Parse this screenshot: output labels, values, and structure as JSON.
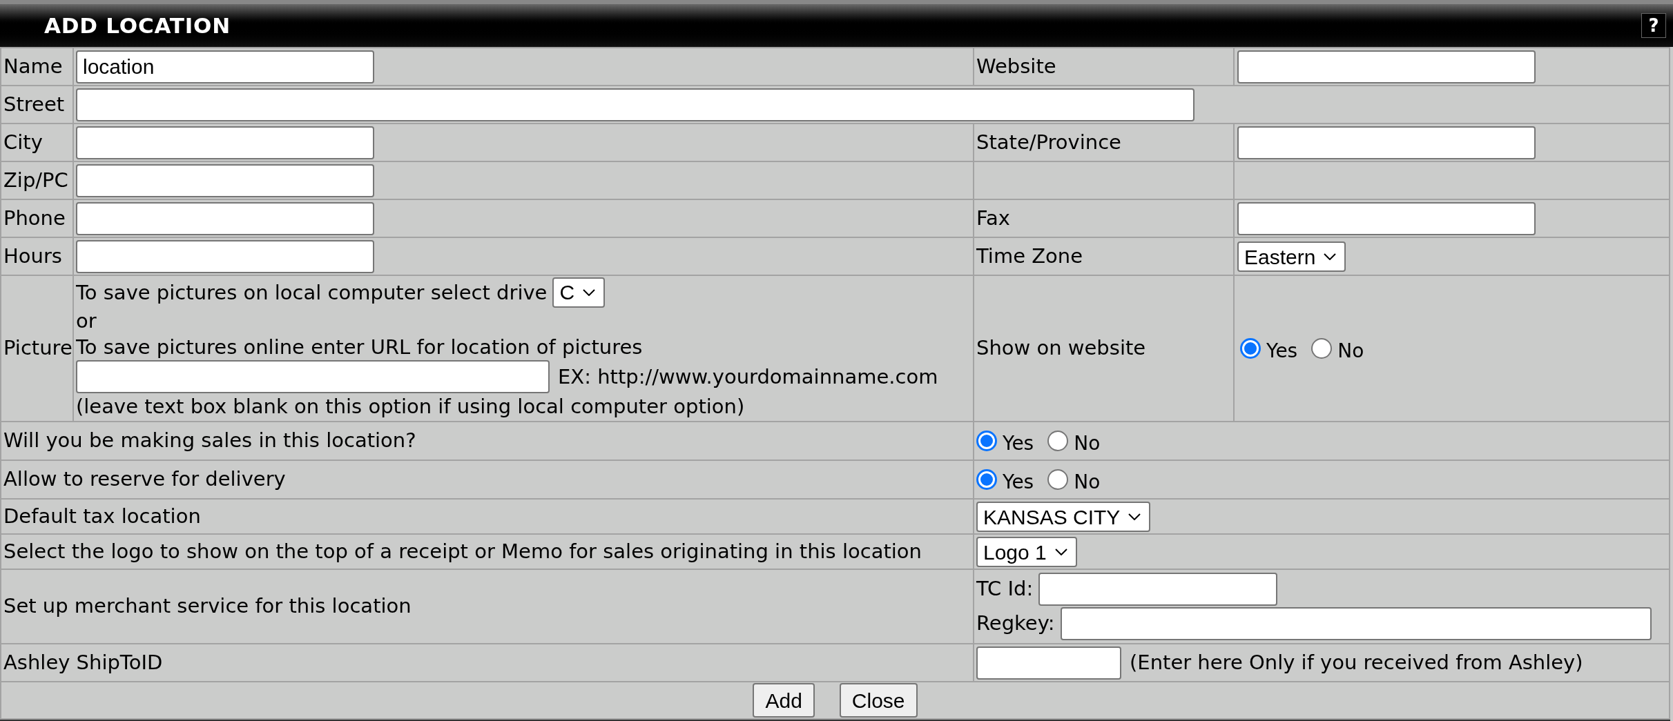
{
  "title": "ADD LOCATION",
  "help_label": "?",
  "top_rows": [
    {
      "label": "Name",
      "value": "location",
      "right": {
        "label": "Website",
        "kind": "input"
      }
    },
    {
      "label": "Street",
      "wide": true
    },
    {
      "label": "City",
      "right": {
        "label": "State/Province",
        "kind": "input"
      }
    },
    {
      "label": "Zip/PC"
    },
    {
      "label": "Phone",
      "right": {
        "label": "Fax",
        "kind": "input"
      }
    },
    {
      "label": "Hours",
      "right": {
        "label": "Time Zone",
        "kind": "select",
        "value": "Eastern"
      }
    }
  ],
  "picture": {
    "label": "Picture",
    "drive_text": "To save pictures on local computer select drive",
    "drive_value": "C",
    "or_text": "or",
    "url_text": "To save pictures online enter URL for location of pictures",
    "example": "EX: http://www.yourdomainname.com",
    "note": "(leave text box blank on this option if using local computer option)",
    "show_label": "Show on website",
    "show_options": [
      {
        "label": "Yes",
        "selected": true
      },
      {
        "label": "No",
        "selected": false
      }
    ]
  },
  "option_rows": [
    {
      "kind": "radio",
      "label": "Will you be making sales in this location?",
      "options": [
        {
          "label": "Yes",
          "selected": true
        },
        {
          "label": "No",
          "selected": false
        }
      ]
    },
    {
      "kind": "radio",
      "label": "Allow to reserve for delivery",
      "options": [
        {
          "label": "Yes",
          "selected": true
        },
        {
          "label": "No",
          "selected": false
        }
      ]
    },
    {
      "kind": "select",
      "label": "Default tax location",
      "value": "KANSAS CITY"
    },
    {
      "kind": "select",
      "label": "Select the logo to show on the top of a receipt or Memo for sales originating in this location",
      "value": "Logo 1"
    },
    {
      "kind": "merchant",
      "label": "Set up merchant service for this location",
      "fields": [
        {
          "label": "TC Id:"
        },
        {
          "label": "Regkey:"
        }
      ]
    },
    {
      "kind": "note_input",
      "label": "Ashley ShipToID",
      "note": "(Enter here Only if you received from Ashley)"
    }
  ],
  "buttons": [
    "Add",
    "Close"
  ]
}
